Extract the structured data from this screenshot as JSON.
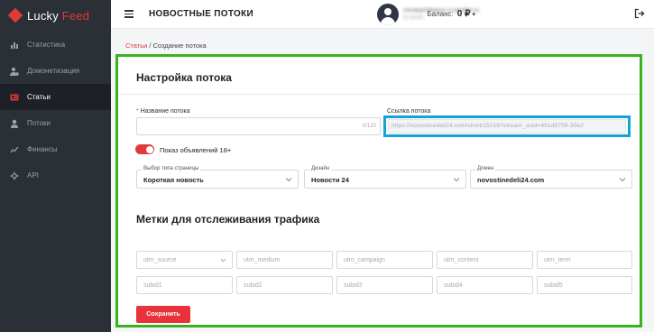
{
  "brand": {
    "name_part1": "Lucky",
    "name_part2": "Feed",
    "accent": "#e23a3a",
    "highlight_green": "#39b21e",
    "highlight_blue": "#13a3d4"
  },
  "sidebar": {
    "items": [
      {
        "label": "Статистика",
        "icon": "stats-icon",
        "active": false
      },
      {
        "label": "Домонетизация",
        "icon": "user-money-icon",
        "active": false
      },
      {
        "label": "Статьи",
        "icon": "article-icon",
        "active": true
      },
      {
        "label": "Потоки",
        "icon": "user-icon",
        "active": false
      },
      {
        "label": "Финансы",
        "icon": "finance-icon",
        "active": false
      },
      {
        "label": "API",
        "icon": "api-icon",
        "active": false
      }
    ]
  },
  "header": {
    "title": "НОВОСТНЫЕ ПОТОКИ",
    "balance_label": "Баланс:",
    "balance_value": "0 ₽",
    "user_email": "romanpchikasov-z-rambler.ru",
    "user_id": "ID 20154"
  },
  "breadcrumb": {
    "parent": "Статьи",
    "separator": "/",
    "current": "Создание потока"
  },
  "form": {
    "title": "Настройка потока",
    "name_label": "Название потока",
    "name_value": "",
    "name_counter": "0/120",
    "link_label": "Ссылка потока",
    "link_value": "https://novostinedeli24.com/short/15016?stream_uuid=491d9759-30e2",
    "toggle_label": "Показ объявлений 18+",
    "toggle_on": true,
    "page_type": {
      "caption": "Выбор типа страницы",
      "value": "Короткая новость"
    },
    "design": {
      "caption": "Дизайн",
      "value": "Новости 24"
    },
    "domain": {
      "caption": "Домен",
      "value": "novostinedeli24.com"
    }
  },
  "tracking": {
    "title": "Метки для отслеживания трафика",
    "utm_placeholders": [
      "utm_source",
      "utm_medium",
      "utm_campaign",
      "utm_content",
      "utm_term"
    ],
    "subid_placeholders": [
      "subid1",
      "subid2",
      "subid3",
      "subid4",
      "subid5"
    ]
  },
  "save_label": "Сохранить"
}
